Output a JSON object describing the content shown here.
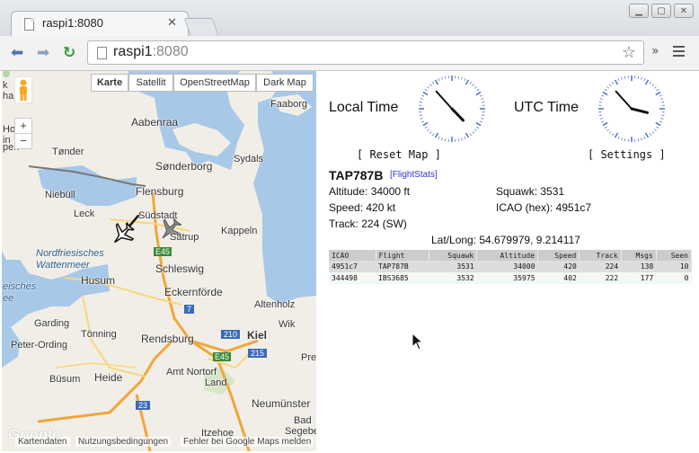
{
  "browser": {
    "tab_title": "raspi1:8080",
    "tab_close": "✕",
    "url_host": "raspi1",
    "url_port": ":8080"
  },
  "map": {
    "types": [
      "Karte",
      "Satellit",
      "OpenStreetMap",
      "Dark Map"
    ],
    "zoom_in": "+",
    "zoom_out": "−",
    "labels": {
      "faaborg": "Faaborg",
      "aabenraa": "Aabenraa",
      "tonder": "Tønder",
      "sonderborg": "Sønderborg",
      "sydals": "Sydals",
      "niebull": "Niebüll",
      "flensburg": "Flensburg",
      "leck": "Leck",
      "sudstadt": "Südstadt",
      "satrup": "Satrup",
      "kappeln": "Kappeln",
      "e45": "E45",
      "nordfriesisches": "Nordfriesisches",
      "wattenmeer": "Wattenmeer",
      "schleswig": "Schleswig",
      "husum": "Husum",
      "eckernforde": "Eckernförde",
      "eis": "eisches",
      "ee": "ee",
      "seven": "7",
      "altenholz": "Altenholz",
      "garding": "Garding",
      "tonning": "Tönning",
      "wik": "Wik",
      "peter_ording": "Peter-Ording",
      "rendsburg": "Rendsburg",
      "r210": "210",
      "kiel": "Kiel",
      "e45b": "E45",
      "r215": "215",
      "pre": "Pre",
      "amt_nortorf": "Amt Nortorf",
      "land": "Land",
      "busum": "Büsum",
      "heide": "Heide",
      "r23": "23",
      "neumunster": "Neumünster",
      "bad": "Bad",
      "segeber": "Segeber",
      "itzehoe": "Itzehoe",
      "hol": "Hol",
      "in": "in",
      "pen": "pen",
      "ha": "ha",
      "k": "k",
      "google": "Google",
      "footer_data": "Kartendaten",
      "footer_terms": "Nutzungsbedingungen",
      "footer_report": "Fehler bei Google Maps melden"
    }
  },
  "clocks": {
    "local_label": "Local Time",
    "utc_label": "UTC Time"
  },
  "buttons": {
    "reset_map": "[ Reset Map ]",
    "settings": "[ Settings ]"
  },
  "selected": {
    "flight": "TAP787B",
    "flightstats": "[FlightStats]",
    "altitude": "Altitude: 34000 ft",
    "squawk": "Squawk: 3531",
    "speed": "Speed: 420 kt",
    "icao": "ICAO (hex): 4951c7",
    "track": "Track: 224 (SW)",
    "latlong": "Lat/Long: 54.679979, 9.214117"
  },
  "table": {
    "headers": [
      "ICAO",
      "Flight",
      "Squawk",
      "Altitude",
      "Speed",
      "Track",
      "Msgs",
      "Seen"
    ],
    "rows": [
      [
        "4951c7",
        "TAP787B",
        "3531",
        "34000",
        "420",
        "224",
        "138",
        "10"
      ],
      [
        "344498",
        "IBS3685",
        "3532",
        "35975",
        "402",
        "222",
        "177",
        "0"
      ]
    ]
  },
  "colors": {
    "map_water": "#a8c8e8",
    "map_land": "#f1eee7",
    "highway": "#f0a63a",
    "road": "#f8d77a",
    "table_header": "#cccccc",
    "selected_row": "#dddddd"
  }
}
